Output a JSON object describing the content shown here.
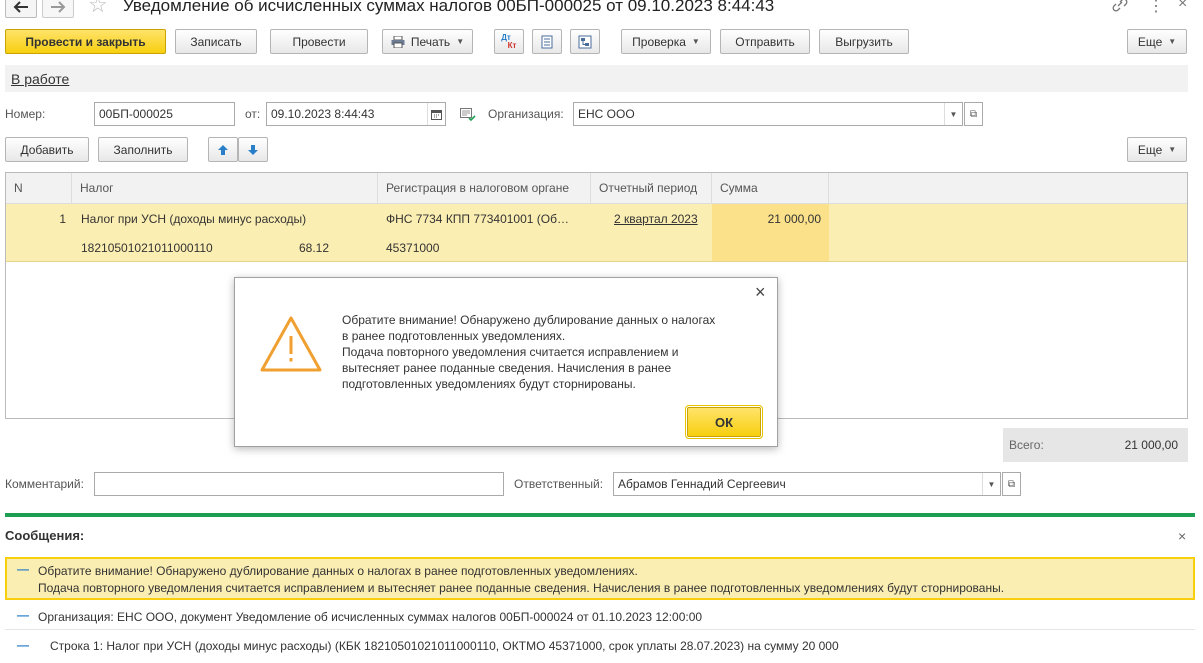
{
  "window": {
    "title": "Уведомление об исчисленных суммах налогов 00БП-000025 от 09.10.2023 8:44:43"
  },
  "toolbar": {
    "post_close": "Провести и закрыть",
    "save": "Записать",
    "post": "Провести",
    "print": "Печать",
    "dtkt_top": "Дт",
    "dtkt_bottom": "Кт",
    "check": "Проверка",
    "send": "Отправить",
    "export": "Выгрузить",
    "more": "Еще"
  },
  "status": {
    "link": "В работе"
  },
  "form": {
    "number_label": "Номер:",
    "number_value": "00БП-000025",
    "date_label": "от:",
    "date_value": "09.10.2023  8:44:43",
    "org_label": "Организация:",
    "org_value": "ЕНС ООО"
  },
  "table_toolbar": {
    "add": "Добавить",
    "fill": "Заполнить",
    "more": "Еще"
  },
  "table": {
    "columns": [
      "N",
      "Налог",
      "Регистрация в налоговом органе",
      "Отчетный период",
      "Сумма"
    ],
    "rows": [
      {
        "n": "1",
        "tax": "Налог при УСН (доходы минус расходы)",
        "kbk": "18210501021011000110",
        "account": "68.12",
        "registration": "ФНС 7734 КПП 773401001 (Об…",
        "oktmo": "45371000",
        "period": "2 квартал 2023",
        "sum": "21 000,00"
      }
    ]
  },
  "totals": {
    "label": "Всего:",
    "value": "21 000,00"
  },
  "footer": {
    "comment_label": "Комментарий:",
    "comment_value": "",
    "responsible_label": "Ответственный:",
    "responsible_value": "Абрамов Геннадий Сергеевич"
  },
  "dialog": {
    "line1": "Обратите внимание! Обнаружено дублирование данных о налогах",
    "line2": "в ранее подготовленных уведомлениях.",
    "line3": "Подача повторного уведомления считается исправлением и",
    "line4": "вытесняет ранее поданные сведения. Начисления в ранее",
    "line5": "подготовленных уведомлениях будут сторнированы.",
    "ok": "ОК"
  },
  "messages": {
    "title": "Сообщения:",
    "items": [
      {
        "line1": "Обратите внимание! Обнаружено дублирование данных о налогах в ранее подготовленных уведомлениях.",
        "line2": "Подача повторного уведомления считается исправлением и вытесняет ранее поданные сведения. Начисления в ранее подготовленных уведомлениях будут сторнированы."
      },
      {
        "line1": "Организация: ЕНС ООО, документ Уведомление об исчисленных суммах налогов 00БП-000024 от 01.10.2023 12:00:00"
      },
      {
        "line1": "Строка 1: Налог при УСН (доходы минус расходы) (КБК 18210501021011000110, ОКТМО 45371000, срок уплаты 28.07.2023) на сумму 20 000"
      }
    ]
  },
  "colors": {
    "accent_yellow": "#f7cf0f",
    "row_selected": "#fbeeb2",
    "sum_cell": "#fae18a",
    "green_separator": "#1e9e52",
    "warning_orange": "#f0a030",
    "link_blue": "#2a7fc9"
  },
  "icons": {
    "back": "arrow-left",
    "forward": "arrow-right",
    "favorite": "star-outline",
    "link": "chain-link",
    "menu": "vertical-dots",
    "print": "printer",
    "warning": "triangle-exclamation"
  }
}
